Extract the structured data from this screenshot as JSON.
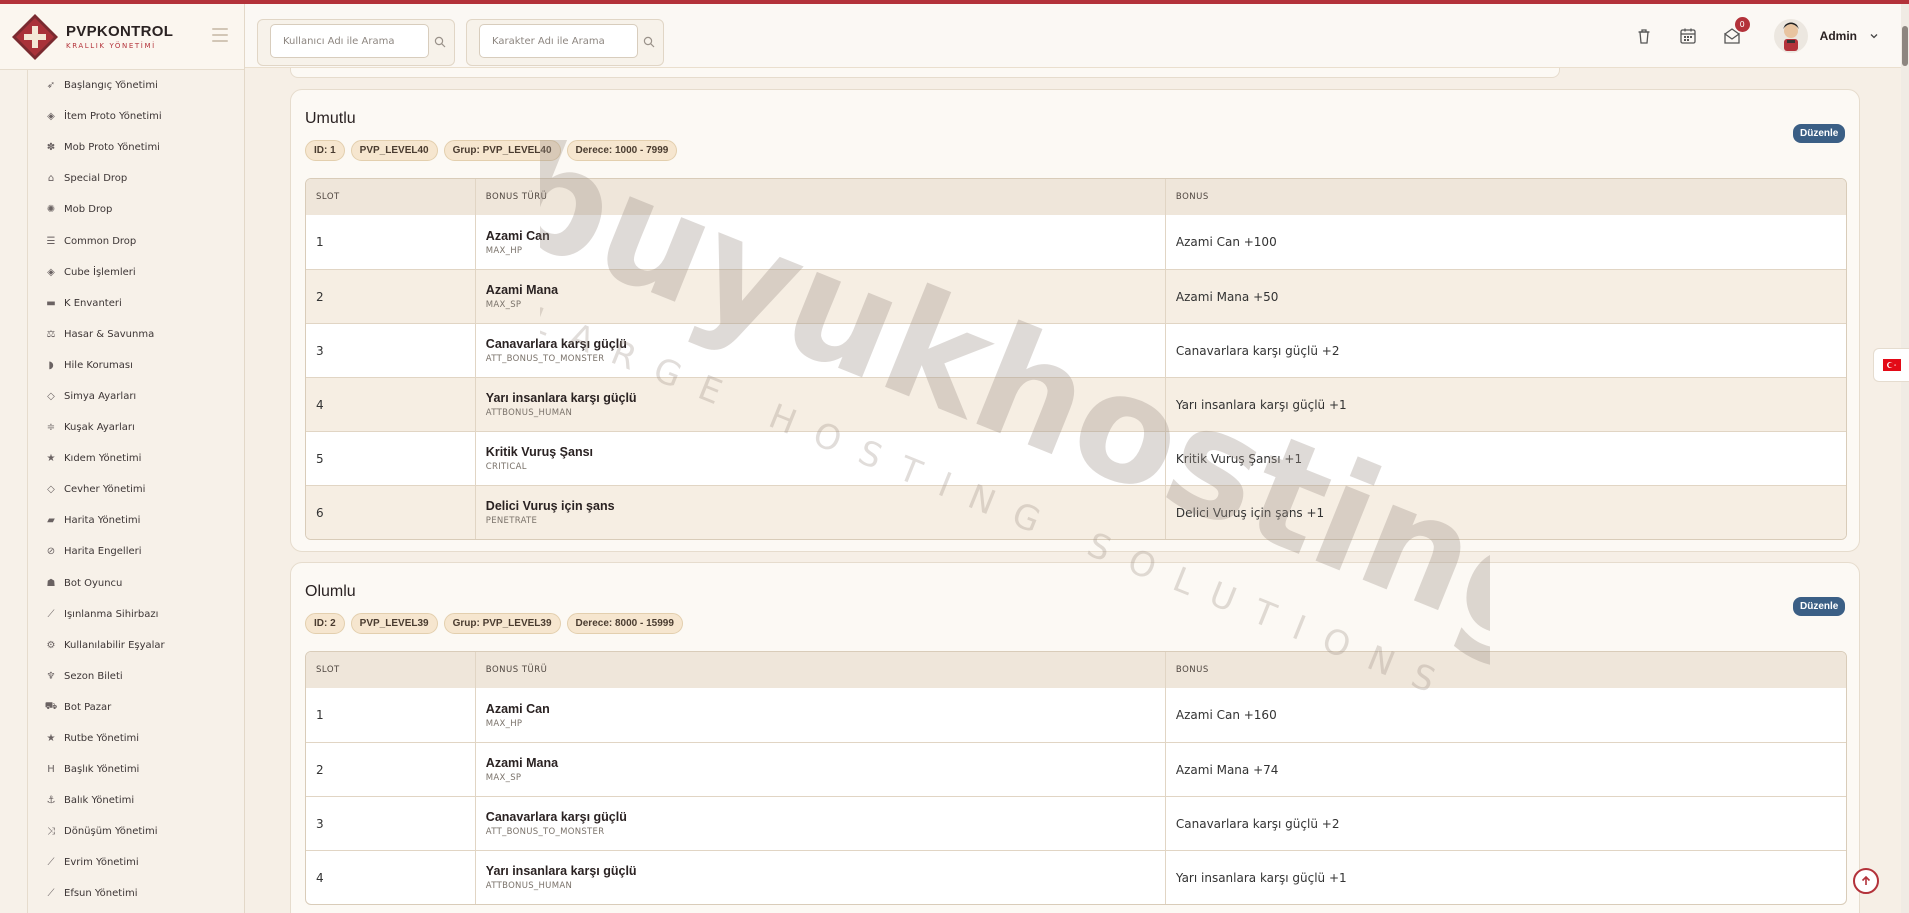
{
  "app": {
    "brand_name": "PVPKONTROL",
    "brand_sub": "KRALLIK YÖNETİMİ"
  },
  "header": {
    "search_user_placeholder": "Kullanıcı Adı ile Arama",
    "search_char_placeholder": "Karakter Adı ile Arama",
    "mail_badge": "0",
    "user_name": "Admin"
  },
  "sidebar": {
    "items": [
      {
        "label": "Başlangıç Yönetimi",
        "icon": "rocket-icon"
      },
      {
        "label": "İtem Proto Yönetimi",
        "icon": "box-icon"
      },
      {
        "label": "Mob Proto Yönetimi",
        "icon": "paw-icon"
      },
      {
        "label": "Special Drop",
        "icon": "gift-icon"
      },
      {
        "label": "Mob Drop",
        "icon": "bug-icon"
      },
      {
        "label": "Common Drop",
        "icon": "list-icon"
      },
      {
        "label": "Cube İşlemleri",
        "icon": "cube-icon"
      },
      {
        "label": "K Envanteri",
        "icon": "inventory-icon"
      },
      {
        "label": "Hasar & Savunma",
        "icon": "scale-icon"
      },
      {
        "label": "Hile Koruması",
        "icon": "shield-icon"
      },
      {
        "label": "Simya Ayarları",
        "icon": "gem-icon"
      },
      {
        "label": "Kuşak Ayarları",
        "icon": "sliders-icon"
      },
      {
        "label": "Kıdem Yönetimi",
        "icon": "star-icon"
      },
      {
        "label": "Cevher Yönetimi",
        "icon": "diamond-icon"
      },
      {
        "label": "Harita Yönetimi",
        "icon": "map-icon"
      },
      {
        "label": "Harita Engelleri",
        "icon": "ban-icon"
      },
      {
        "label": "Bot Oyuncu",
        "icon": "android-icon"
      },
      {
        "label": "Işınlanma Sihirbazı",
        "icon": "wand-icon"
      },
      {
        "label": "Kullanılabilir Eşyalar",
        "icon": "cogs-icon"
      },
      {
        "label": "Sezon Bileti",
        "icon": "trophy-icon"
      },
      {
        "label": "Bot Pazar",
        "icon": "cart-icon"
      },
      {
        "label": "Rutbe Yönetimi",
        "icon": "star-icon"
      },
      {
        "label": "Başlık Yönetimi",
        "icon": "heading-icon"
      },
      {
        "label": "Balık Yönetimi",
        "icon": "anchor-icon"
      },
      {
        "label": "Dönüşüm Yönetimi",
        "icon": "shuffle-icon"
      },
      {
        "label": "Evrim Yönetimi",
        "icon": "wand-icon"
      },
      {
        "label": "Efsun Yönetimi",
        "icon": "wand-icon"
      }
    ]
  },
  "table_headers": {
    "slot": "SLOT",
    "bonus_type": "BONUS TÜRÜ",
    "bonus": "BONUS"
  },
  "edit_label": "Düzenle",
  "groups": [
    {
      "title": "Umutlu",
      "chips": [
        "ID: 1",
        "PVP_LEVEL40",
        "Grup: PVP_LEVEL40",
        "Derece: 1000 - 7999"
      ],
      "rows": [
        {
          "slot": "1",
          "name": "Azami Can",
          "code": "MAX_HP",
          "bonus": "Azami Can +100"
        },
        {
          "slot": "2",
          "name": "Azami Mana",
          "code": "MAX_SP",
          "bonus": "Azami Mana +50"
        },
        {
          "slot": "3",
          "name": "Canavarlara karşı güçlü",
          "code": "ATT_BONUS_TO_MONSTER",
          "bonus": "Canavarlara karşı güçlü +2"
        },
        {
          "slot": "4",
          "name": "Yarı insanlara karşı güçlü",
          "code": "ATTBONUS_HUMAN",
          "bonus": "Yarı insanlara karşı güçlü +1"
        },
        {
          "slot": "5",
          "name": "Kritik Vuruş Şansı",
          "code": "CRITICAL",
          "bonus": "Kritik Vuruş Şansı +1"
        },
        {
          "slot": "6",
          "name": "Delici Vuruş için şans",
          "code": "PENETRATE",
          "bonus": "Delici Vuruş için şans +1"
        }
      ]
    },
    {
      "title": "Olumlu",
      "chips": [
        "ID: 2",
        "PVP_LEVEL39",
        "Grup: PVP_LEVEL39",
        "Derece: 8000 - 15999"
      ],
      "rows": [
        {
          "slot": "1",
          "name": "Azami Can",
          "code": "MAX_HP",
          "bonus": "Azami Can +160"
        },
        {
          "slot": "2",
          "name": "Azami Mana",
          "code": "MAX_SP",
          "bonus": "Azami Mana +74"
        },
        {
          "slot": "3",
          "name": "Canavarlara karşı güçlü",
          "code": "ATT_BONUS_TO_MONSTER",
          "bonus": "Canavarlara karşı güçlü +2"
        },
        {
          "slot": "4",
          "name": "Yarı insanlara karşı güçlü",
          "code": "ATTBONUS_HUMAN",
          "bonus": "Yarı insanlara karşı güçlü +1"
        }
      ]
    }
  ],
  "watermark": {
    "main": "buyukhosting",
    "sub": "LARGE HOSTING SOLUTIONS"
  },
  "colors": {
    "accent": "#b3323a",
    "edit": "#3b5f85",
    "chip_bg": "#f6e6cf"
  }
}
